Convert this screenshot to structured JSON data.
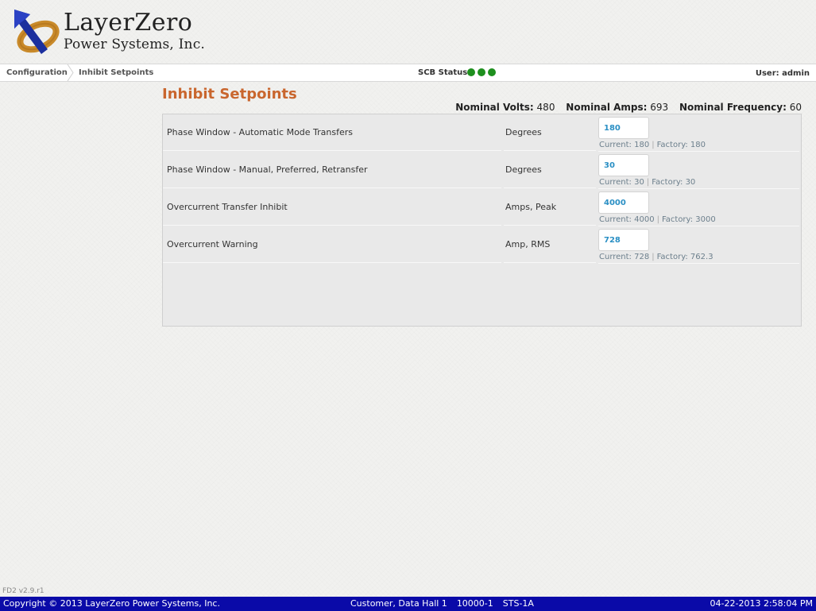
{
  "brand": {
    "line1": "LayerZero",
    "line2": "Power Systems, Inc.",
    "colors": {
      "arrow": "#1c2f9e",
      "ring": "#c98a2a"
    }
  },
  "nav": {
    "breadcrumb": [
      "Configuration",
      "Inhibit Setpoints"
    ],
    "scb_label": "SCB Status:",
    "scb_dots": [
      "#1e8f1e",
      "#1e8f1e",
      "#1e8f1e"
    ],
    "user": "User: admin"
  },
  "page": {
    "title": "Inhibit Setpoints",
    "nominal": {
      "volts_label": "Nominal Volts:",
      "volts": "480",
      "amps_label": "Nominal Amps:",
      "amps": "693",
      "freq_label": "Nominal Frequency:",
      "freq": "60"
    }
  },
  "setpoints": [
    {
      "name": "Phase Window - Automatic Mode Transfers",
      "unit": "Degrees",
      "value": "180",
      "current_label": "Current: 180",
      "factory_label": "Factory: 180"
    },
    {
      "name": "Phase Window - Manual, Preferred, Retransfer",
      "unit": "Degrees",
      "value": "30",
      "current_label": "Current: 30",
      "factory_label": "Factory: 30"
    },
    {
      "name": "Overcurrent Transfer Inhibit",
      "unit": "Amps, Peak",
      "value": "4000",
      "current_label": "Current: 4000",
      "factory_label": "Factory: 3000"
    },
    {
      "name": "Overcurrent Warning",
      "unit": "Amp, RMS",
      "value": "728",
      "current_label": "Current: 728",
      "factory_label": "Factory: 762.3"
    }
  ],
  "separator": "|",
  "version": "FD2 v2.9.r1",
  "footer": {
    "copyright": "Copyright © 2013 LayerZero Power Systems, Inc.",
    "customer": "Customer, Data Hall 1",
    "serial": "10000-1",
    "unit": "STS-1A",
    "datetime": "04-22-2013 2:58:04 PM"
  }
}
